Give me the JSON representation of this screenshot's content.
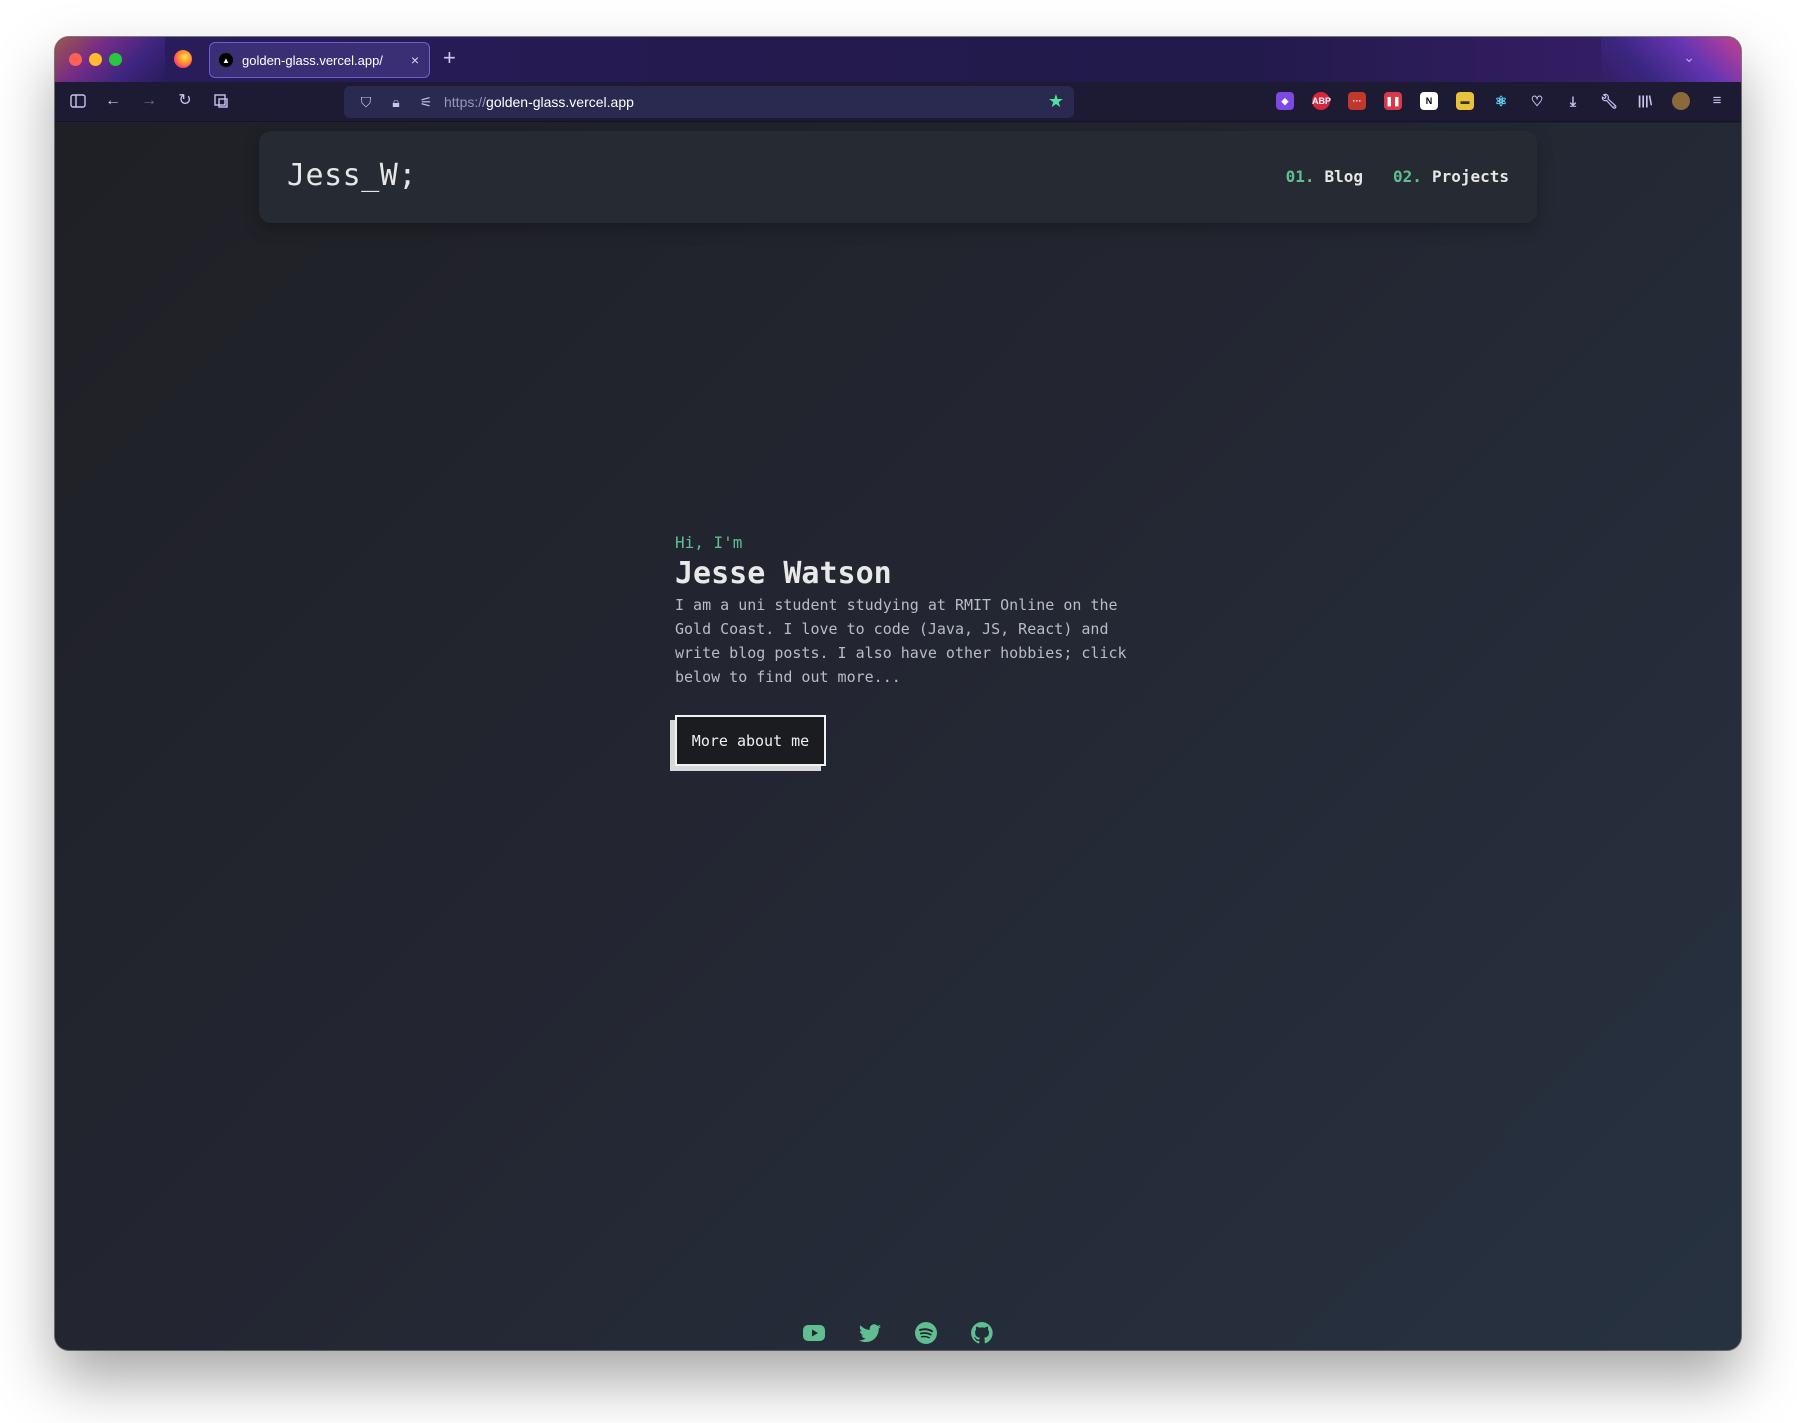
{
  "browser": {
    "tab_title": "golden-glass.vercel.app/",
    "tab_favicon": "▲",
    "tab_close": "×",
    "new_tab": "+",
    "url_protocol": "https://",
    "url_host": "golden-glass.vercel.app"
  },
  "site": {
    "logo": "Jess_W;",
    "nav": [
      {
        "num": "01.",
        "label": "Blog"
      },
      {
        "num": "02.",
        "label": "Projects"
      }
    ]
  },
  "hero": {
    "greeting": "Hi, I'm",
    "name": "Jesse Watson",
    "bio": "I am a uni student studying at RMIT Online on the Gold Coast. I love to code (Java, JS, React) and write blog posts. I also have other hobbies; click below to find out more...",
    "button_label": "More about me"
  },
  "socials": [
    "youtube-icon",
    "twitter-icon",
    "spotify-icon",
    "github-icon"
  ],
  "colors": {
    "accent": "#5fbf90",
    "background": "#23262f",
    "nav_bg": "#262b33",
    "text": "#e6e6e6"
  }
}
